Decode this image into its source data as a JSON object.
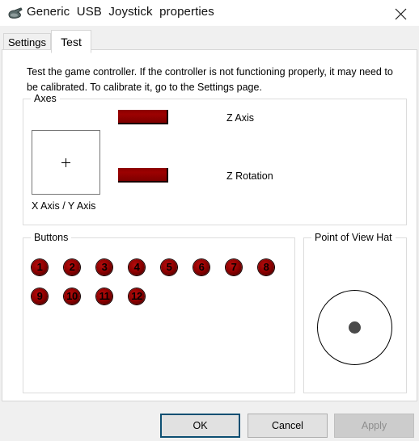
{
  "window": {
    "title": "Generic  USB  Joystick  properties",
    "icon": "joystick-icon",
    "close_label": "✕"
  },
  "tabs": [
    {
      "label": "Settings",
      "active": false
    },
    {
      "label": "Test",
      "active": true
    }
  ],
  "content": {
    "instructions": "Test the game controller.  If the controller is not functioning properly, it may need to be calibrated.  To calibrate it, go to the Settings page."
  },
  "axes_group": {
    "title": "Axes",
    "xy_label": "X Axis / Y Axis",
    "crosshair": {
      "x_percent": 50,
      "y_percent": 50
    },
    "bars": [
      {
        "name": "Z Axis",
        "fill_percent": 50,
        "color": "#8c0000"
      },
      {
        "name": "Z Rotation",
        "fill_percent": 50,
        "color": "#8c0000"
      }
    ]
  },
  "buttons_group": {
    "title": "Buttons",
    "indicators": [
      {
        "label": "1",
        "pressed": false
      },
      {
        "label": "2",
        "pressed": false
      },
      {
        "label": "3",
        "pressed": false
      },
      {
        "label": "4",
        "pressed": false
      },
      {
        "label": "5",
        "pressed": false
      },
      {
        "label": "6",
        "pressed": false
      },
      {
        "label": "7",
        "pressed": false
      },
      {
        "label": "8",
        "pressed": false
      },
      {
        "label": "9",
        "pressed": false
      },
      {
        "label": "10",
        "pressed": false
      },
      {
        "label": "11",
        "pressed": false
      },
      {
        "label": "12",
        "pressed": false
      }
    ],
    "columns": 8,
    "accent_color": "#8e0000"
  },
  "pov_group": {
    "title": "Point of View Hat",
    "center_color": "#4a4a4a",
    "direction": "centered"
  },
  "footer": {
    "ok_label": "OK",
    "cancel_label": "Cancel",
    "apply_label": "Apply",
    "apply_enabled": false,
    "focus_color": "#0d4f72"
  }
}
